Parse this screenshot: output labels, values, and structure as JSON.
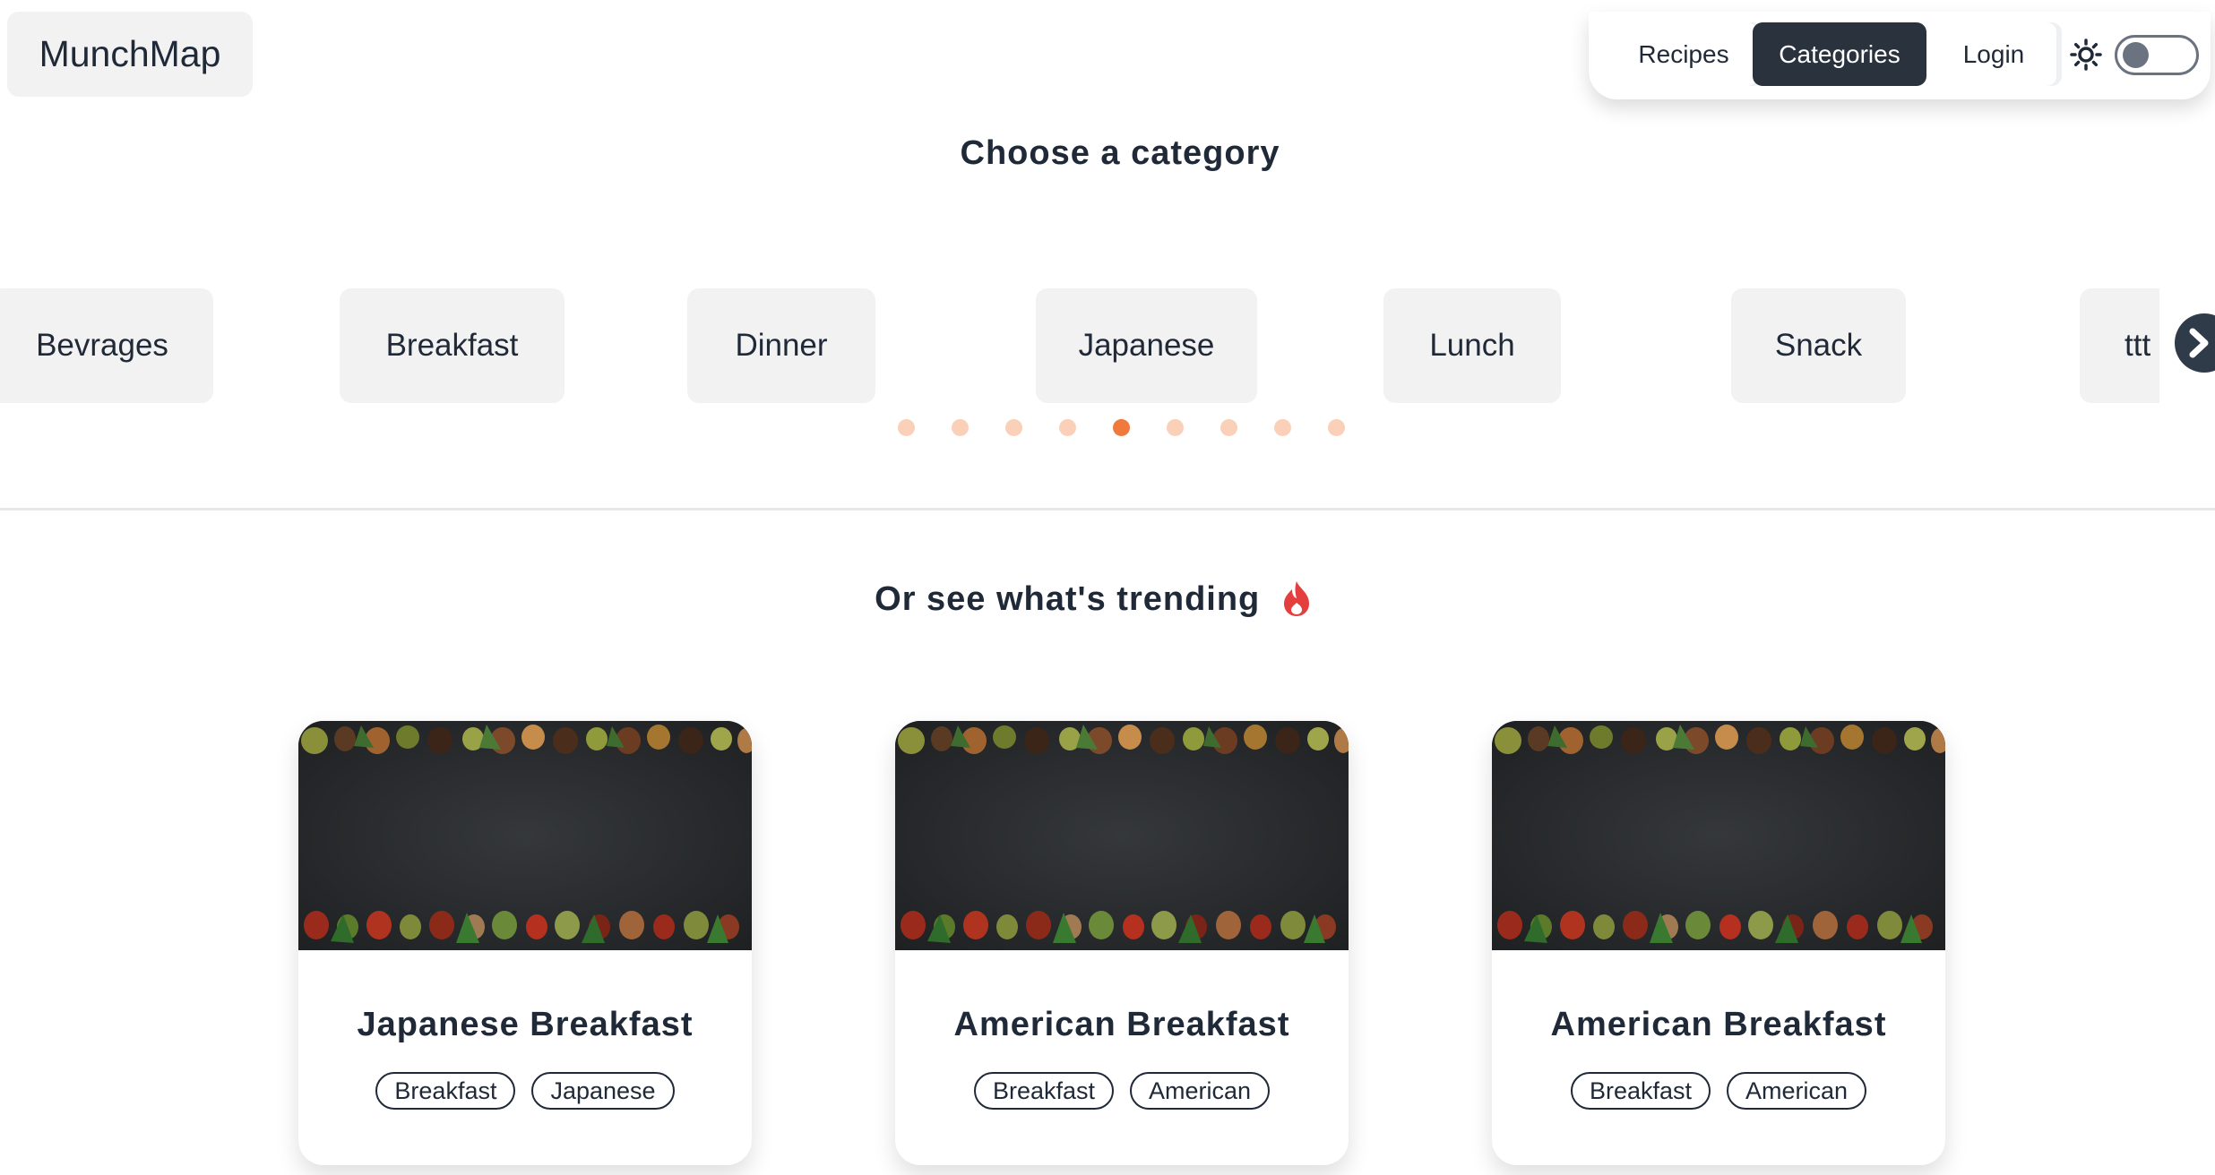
{
  "header": {
    "logo": "MunchMap",
    "nav": [
      {
        "label": "Recipes",
        "active": false
      },
      {
        "label": "Categories",
        "active": true
      },
      {
        "label": "Login",
        "active": false
      }
    ],
    "theme_icon": "sun-icon",
    "theme_toggle_on": false
  },
  "categories": {
    "heading": "Choose a category",
    "items": [
      "Bevrages",
      "Breakfast",
      "Dinner",
      "Japanese",
      "Lunch",
      "Snack",
      "ttt"
    ],
    "next_icon": "chevron-right-icon",
    "dot_count": 9,
    "active_dot": 4
  },
  "trending": {
    "heading": "Or see what's trending",
    "heading_icon": "fire-icon",
    "cards": [
      {
        "title": "Japanese Breakfast",
        "tags": [
          "Breakfast",
          "Japanese"
        ]
      },
      {
        "title": "American Breakfast",
        "tags": [
          "Breakfast",
          "American"
        ]
      },
      {
        "title": "American Breakfast",
        "tags": [
          "Breakfast",
          "American"
        ]
      }
    ]
  },
  "colors": {
    "accent": "#ef7a3b",
    "dot_inactive": "#fbd0b8",
    "nav_active_bg": "#2a323d",
    "text": "#1f2937",
    "fire": "#e53e3e"
  }
}
